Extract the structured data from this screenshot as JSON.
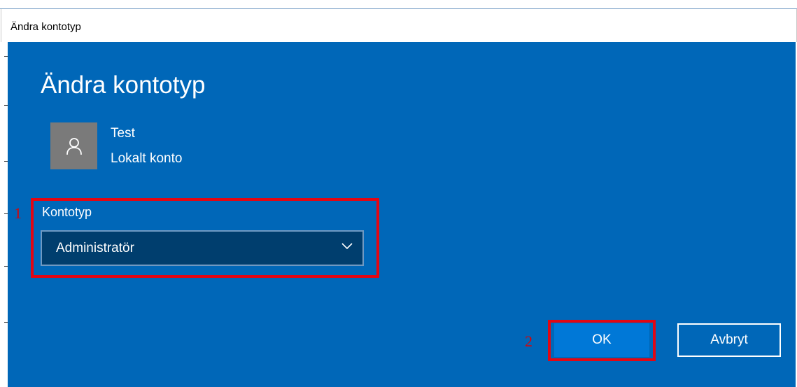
{
  "window": {
    "title": "Ändra kontotyp"
  },
  "dialog": {
    "heading": "Ändra kontotyp",
    "user": {
      "name": "Test",
      "account_type": "Lokalt konto",
      "avatar_icon": "person-icon"
    },
    "account_type_field": {
      "label": "Kontotyp",
      "selected_value": "Administratör"
    },
    "buttons": {
      "ok_label": "OK",
      "cancel_label": "Avbryt"
    }
  },
  "annotations": {
    "marker_1": "1",
    "marker_2": "2"
  },
  "colors": {
    "dialog_background": "#0067b8",
    "highlight": "#e30613",
    "primary_button": "#0078d7",
    "dropdown_background": "#003e6e",
    "avatar_background": "#7a7a7a"
  }
}
